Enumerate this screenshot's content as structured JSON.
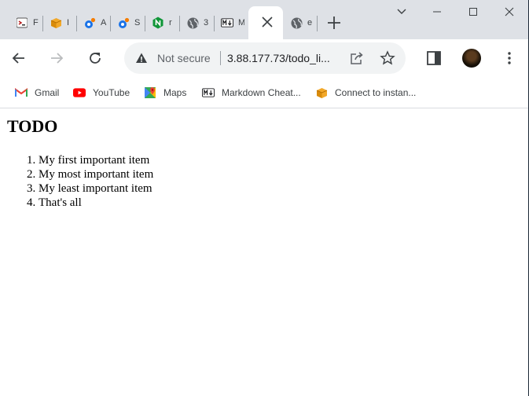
{
  "tabs": [
    {
      "title": "F",
      "icon": "terminal-icon"
    },
    {
      "title": "I",
      "icon": "aws-box-icon"
    },
    {
      "title": "A",
      "icon": "app-icon"
    },
    {
      "title": "S",
      "icon": "app-icon"
    },
    {
      "title": "r",
      "icon": "nginx-icon"
    },
    {
      "title": "3",
      "icon": "globe-icon"
    },
    {
      "title": "M",
      "icon": "markdown-icon"
    },
    {
      "title": "",
      "icon": "close-icon",
      "active": true
    },
    {
      "title": "e",
      "icon": "globe-icon"
    }
  ],
  "omnibox": {
    "security_label": "Not secure",
    "url": "3.88.177.73/todo_li..."
  },
  "bookmarks": [
    {
      "label": "Gmail",
      "icon": "gmail-icon"
    },
    {
      "label": "YouTube",
      "icon": "youtube-icon"
    },
    {
      "label": "Maps",
      "icon": "maps-icon"
    },
    {
      "label": "Markdown Cheat...",
      "icon": "markdown-icon"
    },
    {
      "label": "Connect to instan...",
      "icon": "aws-box-icon"
    }
  ],
  "page": {
    "heading": "TODO",
    "items": [
      "My first important item",
      "My most important item",
      "My least important item",
      "That's all"
    ]
  },
  "colors": {
    "tabstrip": "#dee1e6",
    "omnibox": "#f1f3f4",
    "nginx": "#119639",
    "aws": "#f2a829",
    "youtube": "#ff0000",
    "app_blue": "#1a73e8",
    "app_orange": "#f57c00"
  }
}
